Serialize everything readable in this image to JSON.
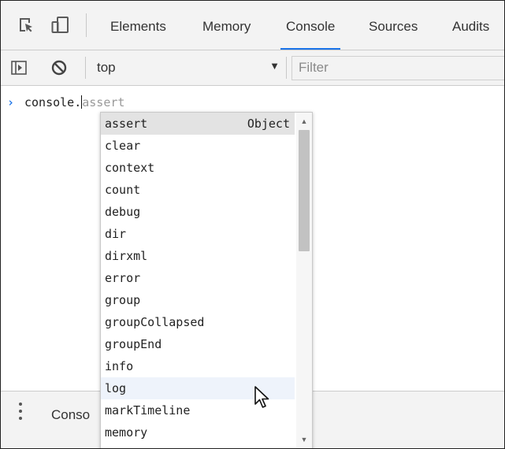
{
  "toolbar": {
    "tabs": [
      {
        "label": "Elements"
      },
      {
        "label": "Memory"
      },
      {
        "label": "Console",
        "active": true
      },
      {
        "label": "Sources"
      },
      {
        "label": "Audits"
      }
    ]
  },
  "console_toolbar": {
    "context": "top",
    "filter_placeholder": "Filter"
  },
  "console": {
    "typed": "console.",
    "ghost_completion": "assert"
  },
  "autocomplete": {
    "items": [
      {
        "label": "assert",
        "type": "Object",
        "selected": true
      },
      {
        "label": "clear"
      },
      {
        "label": "context"
      },
      {
        "label": "count"
      },
      {
        "label": "debug"
      },
      {
        "label": "dir"
      },
      {
        "label": "dirxml"
      },
      {
        "label": "error"
      },
      {
        "label": "group"
      },
      {
        "label": "groupCollapsed"
      },
      {
        "label": "groupEnd"
      },
      {
        "label": "info"
      },
      {
        "label": "log",
        "hovered": true
      },
      {
        "label": "markTimeline"
      },
      {
        "label": "memory"
      }
    ]
  },
  "drawer": {
    "tab_label": "Conso"
  },
  "colors": {
    "accent": "#1a73e8",
    "selected_row": "#e3e3e3",
    "hovered_row": "#eef3fb",
    "panel_bg": "#f3f3f3"
  },
  "icons": [
    "inspect-element-icon",
    "device-toggle-icon",
    "show-sidebar-icon",
    "clear-console-icon",
    "dropdown-arrow-icon",
    "drawer-menu-icon",
    "scroll-up-icon",
    "scroll-down-icon",
    "mouse-pointer-icon"
  ]
}
